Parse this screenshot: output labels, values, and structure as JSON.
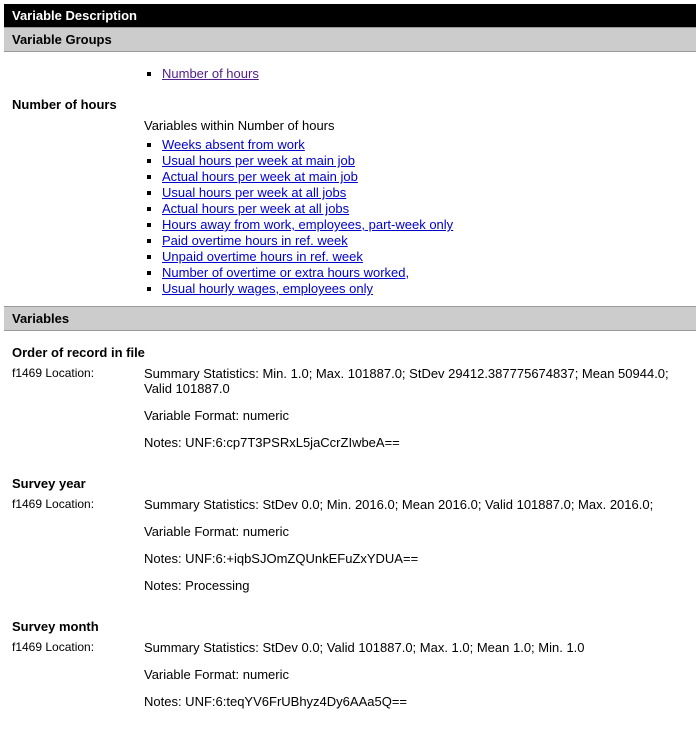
{
  "title": "Variable Description",
  "groups_header": "Variable Groups",
  "top_link": "Number of hours",
  "group_section_title": "Number of hours",
  "group_list_caption": "Variables within Number of hours",
  "group_links": [
    "Weeks absent from work",
    "Usual hours per week at main job",
    "Actual hours per week at main job",
    "Usual hours per week at all jobs",
    "Actual hours per week at all jobs",
    "Hours away from work, employees, part-week only",
    "Paid overtime hours in ref. week",
    "Unpaid overtime hours in ref. week",
    "Number of overtime or extra hours worked,",
    "Usual hourly wages, employees only"
  ],
  "variables_header": "Variables",
  "variables": [
    {
      "name": "Order of record in file",
      "location": "f1469 Location:",
      "lines": [
        "Summary Statistics: Min. 1.0; Max. 101887.0; StDev 29412.387775674837; Mean 50944.0; Valid 101887.0",
        "Variable Format: numeric",
        "Notes: UNF:6:cp7T3PSRxL5jaCcrZIwbeA=="
      ]
    },
    {
      "name": "Survey year",
      "location": "f1469 Location:",
      "lines": [
        "Summary Statistics: StDev 0.0; Min. 2016.0; Mean 2016.0; Valid 101887.0; Max. 2016.0;",
        "Variable Format: numeric",
        "Notes: UNF:6:+iqbSJOmZQUnkEFuZxYDUA==",
        "Notes: Processing"
      ]
    },
    {
      "name": "Survey month",
      "location": "f1469 Location:",
      "lines": [
        "Summary Statistics: StDev 0.0; Valid 101887.0; Max. 1.0; Mean 1.0; Min. 1.0",
        "Variable Format: numeric",
        "Notes: UNF:6:teqYV6FrUBhyz4Dy6AAa5Q=="
      ]
    }
  ]
}
